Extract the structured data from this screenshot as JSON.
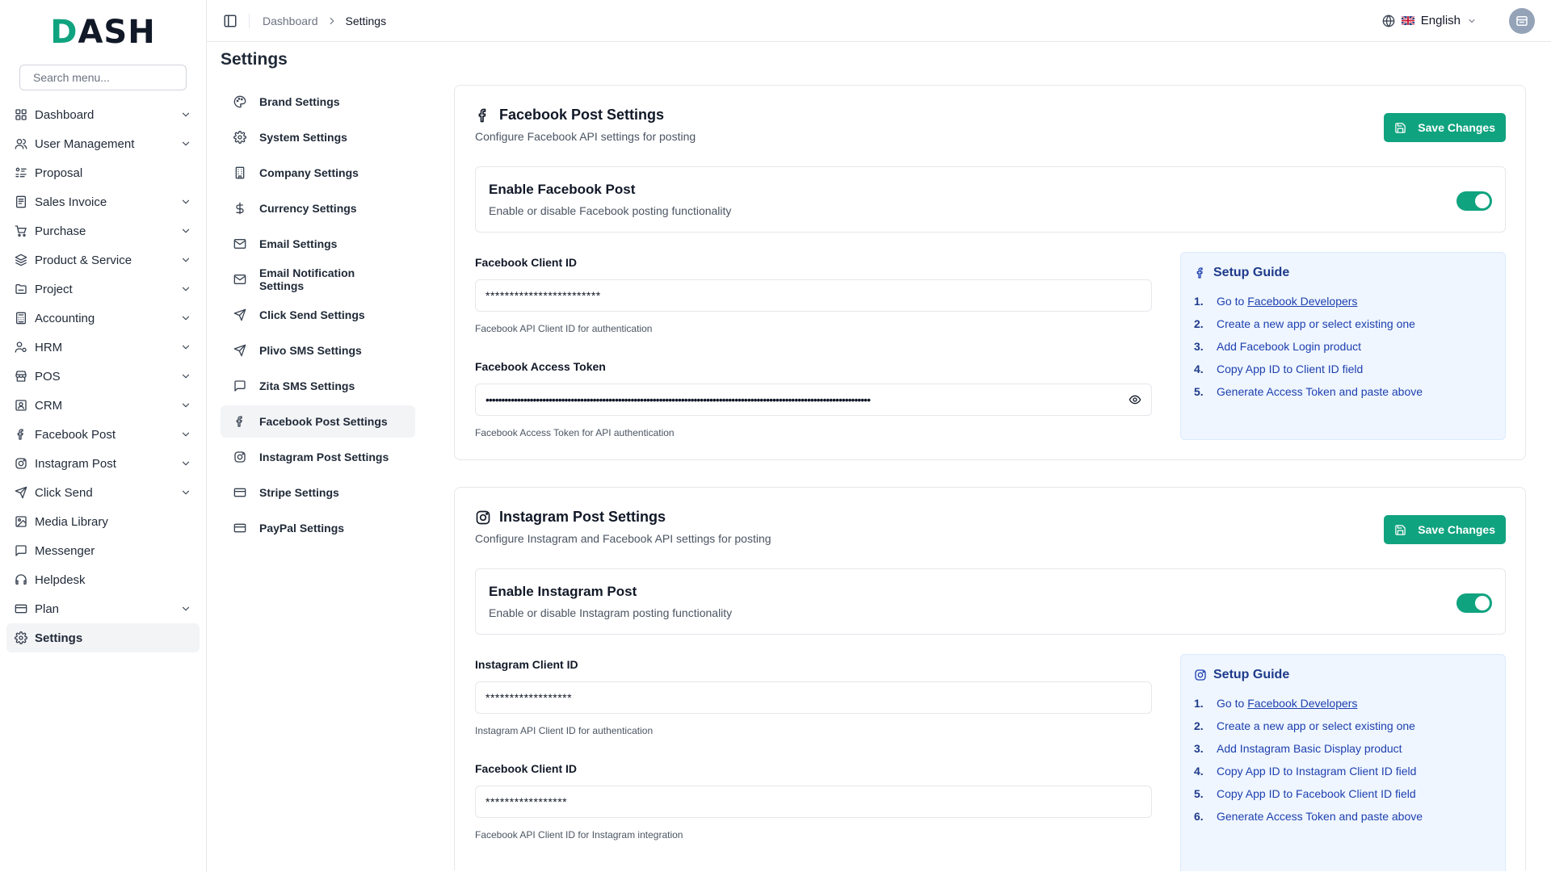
{
  "app": {
    "logo_prefix": "D",
    "logo_rest": "ASH",
    "search_placeholder": "Search menu..."
  },
  "sidebar": {
    "items": [
      {
        "label": "Dashboard",
        "icon": "grid-icon",
        "chevron": true
      },
      {
        "label": "User Management",
        "icon": "users-icon",
        "chevron": true
      },
      {
        "label": "Proposal",
        "icon": "proposal-icon",
        "chevron": false
      },
      {
        "label": "Sales Invoice",
        "icon": "invoice-icon",
        "chevron": true
      },
      {
        "label": "Purchase",
        "icon": "cart-icon",
        "chevron": true
      },
      {
        "label": "Product & Service",
        "icon": "layers-icon",
        "chevron": true
      },
      {
        "label": "Project",
        "icon": "folder-icon",
        "chevron": true
      },
      {
        "label": "Accounting",
        "icon": "calculator-icon",
        "chevron": true
      },
      {
        "label": "HRM",
        "icon": "user-cog-icon",
        "chevron": true
      },
      {
        "label": "POS",
        "icon": "store-icon",
        "chevron": true
      },
      {
        "label": "CRM",
        "icon": "contact-icon",
        "chevron": true
      },
      {
        "label": "Facebook Post",
        "icon": "facebook-icon",
        "chevron": true
      },
      {
        "label": "Instagram Post",
        "icon": "instagram-icon",
        "chevron": true
      },
      {
        "label": "Click Send",
        "icon": "send-icon",
        "chevron": true
      },
      {
        "label": "Media Library",
        "icon": "image-icon",
        "chevron": false
      },
      {
        "label": "Messenger",
        "icon": "message-icon",
        "chevron": false
      },
      {
        "label": "Helpdesk",
        "icon": "headphones-icon",
        "chevron": false
      },
      {
        "label": "Plan",
        "icon": "card-icon",
        "chevron": true
      },
      {
        "label": "Settings",
        "icon": "gear-icon",
        "chevron": false,
        "active": true
      }
    ]
  },
  "topbar": {
    "breadcrumb": [
      "Dashboard",
      "Settings"
    ],
    "language": "English"
  },
  "page": {
    "title": "Settings"
  },
  "settings_menu": {
    "items": [
      {
        "label": "Brand Settings",
        "icon": "palette-icon"
      },
      {
        "label": "System Settings",
        "icon": "gear-icon"
      },
      {
        "label": "Company Settings",
        "icon": "building-icon"
      },
      {
        "label": "Currency Settings",
        "icon": "dollar-icon"
      },
      {
        "label": "Email Settings",
        "icon": "mail-icon"
      },
      {
        "label": "Email Notification Settings",
        "icon": "mail-icon"
      },
      {
        "label": "Click Send Settings",
        "icon": "send-icon"
      },
      {
        "label": "Plivo SMS Settings",
        "icon": "send-icon"
      },
      {
        "label": "Zita SMS Settings",
        "icon": "message-icon"
      },
      {
        "label": "Facebook Post Settings",
        "icon": "facebook-icon",
        "active": true
      },
      {
        "label": "Instagram Post Settings",
        "icon": "instagram-icon"
      },
      {
        "label": "Stripe Settings",
        "icon": "card-icon"
      },
      {
        "label": "PayPal Settings",
        "icon": "card-icon"
      }
    ]
  },
  "facebook": {
    "title": "Facebook Post Settings",
    "subtitle": "Configure Facebook API settings for posting",
    "save_label": "Save Changes",
    "toggle_title": "Enable Facebook Post",
    "toggle_sub": "Enable or disable Facebook posting functionality",
    "toggle_on": true,
    "client_id_label": "Facebook Client ID",
    "client_id_value": "************************",
    "client_id_help": "Facebook API Client ID for authentication",
    "token_label": "Facebook Access Token",
    "token_value": "••••••••••••••••••••••••••••••••••••••••••••••••••••••••••••••••••••••••••••••••••••••••••••••••••••••••••••••••••••••••••",
    "token_help": "Facebook Access Token for API authentication",
    "guide_title": "Setup Guide",
    "guide_link": "Facebook Developers",
    "guide_steps": [
      "Go to",
      "Create a new app or select existing one",
      "Add Facebook Login product",
      "Copy App ID to Client ID field",
      "Generate Access Token and paste above"
    ]
  },
  "instagram": {
    "title": "Instagram Post Settings",
    "subtitle": "Configure Instagram and Facebook API settings for posting",
    "save_label": "Save Changes",
    "toggle_title": "Enable Instagram Post",
    "toggle_sub": "Enable or disable Instagram posting functionality",
    "toggle_on": true,
    "client_id_label": "Instagram Client ID",
    "client_id_value": "******************",
    "client_id_help": "Instagram API Client ID for authentication",
    "fb_client_id_label": "Facebook Client ID",
    "fb_client_id_value": "*****************",
    "fb_client_id_help": "Facebook API Client ID for Instagram integration",
    "guide_title": "Setup Guide",
    "guide_link": "Facebook Developers",
    "guide_steps": [
      "Go to",
      "Create a new app or select existing one",
      "Add Instagram Basic Display product",
      "Copy App ID to Instagram Client ID field",
      "Copy App ID to Facebook Client ID field",
      "Generate Access Token and paste above"
    ]
  },
  "colors": {
    "accent": "#10a37f",
    "guide_bg": "#eff6ff",
    "guide_text": "#1e40af"
  }
}
